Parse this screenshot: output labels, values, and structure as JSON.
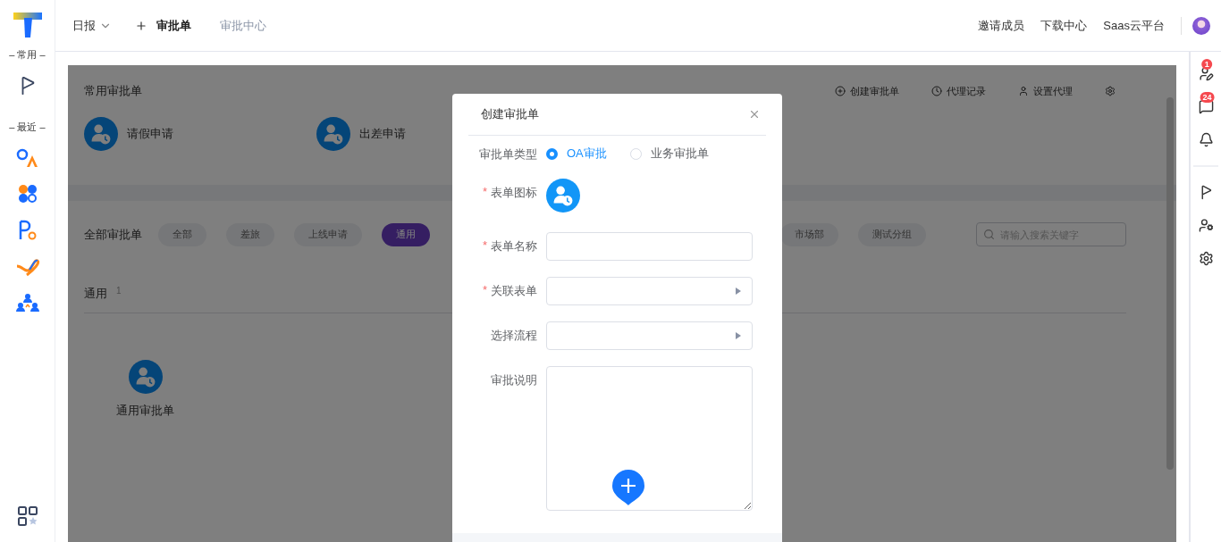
{
  "sidebar": {
    "sections": [
      "– 常用 –",
      "– 最近 –"
    ]
  },
  "topbar": {
    "menu": {
      "label": "日报"
    },
    "tabs": [
      {
        "label": "审批单",
        "kind": "add",
        "selected": true
      },
      {
        "label": "审批中心",
        "kind": "plain",
        "selected": false
      }
    ],
    "links": [
      "邀请成员",
      "下载中心",
      "Saas云平台"
    ]
  },
  "right_rail": {
    "badges": [
      "1",
      "24"
    ]
  },
  "common": {
    "title": "常用审批单",
    "actions": [
      "创建审批单",
      "代理记录",
      "设置代理"
    ],
    "items": [
      "请假申请",
      "出差申请"
    ]
  },
  "all": {
    "title": "全部审批单",
    "filters": [
      {
        "label": "全部",
        "selected": false
      },
      {
        "label": "差旅",
        "selected": false
      },
      {
        "label": "上线申请",
        "selected": false
      },
      {
        "label": "通用",
        "selected": true
      },
      {
        "label": "市场部",
        "selected": false
      },
      {
        "label": "测试分组",
        "selected": false
      }
    ],
    "search": {
      "placeholder": "请输入搜索关键字"
    },
    "groups": [
      {
        "name": "通用",
        "count": "1",
        "items": [
          "通用审批单"
        ]
      }
    ]
  },
  "dialog": {
    "title": "创建审批单",
    "fields": [
      {
        "kind": "radio",
        "label": "审批单类型",
        "options": [
          {
            "label": "OA审批",
            "selected": true
          },
          {
            "label": "业务审批单",
            "selected": false
          }
        ]
      },
      {
        "kind": "icon",
        "label": "表单图标",
        "mark": "*"
      },
      {
        "kind": "input",
        "label": "表单名称",
        "mark": "*"
      },
      {
        "kind": "select",
        "label": "关联表单",
        "mark": "*"
      },
      {
        "kind": "select",
        "label": "选择流程"
      },
      {
        "kind": "textarea",
        "label": "审批说明"
      }
    ]
  }
}
